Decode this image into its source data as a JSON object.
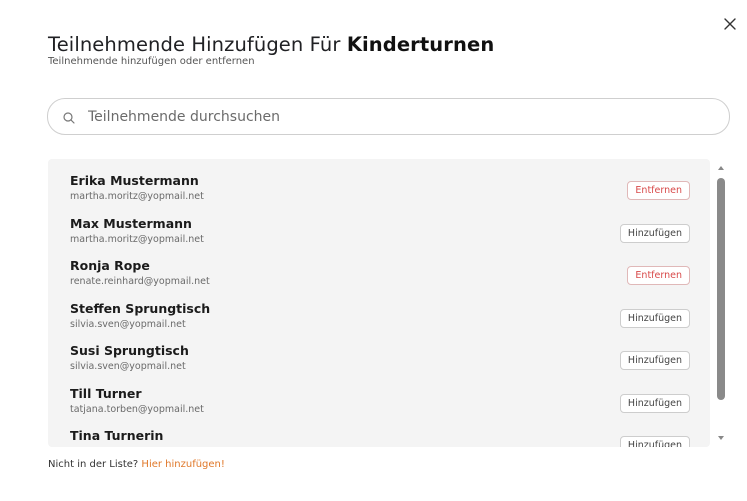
{
  "dialog": {
    "title_prefix": "Teilnehmende Hinzufügen Für",
    "title_course": "Kinderturnen",
    "subtitle": "Teilnehmende hinzufügen oder entfernen"
  },
  "search": {
    "placeholder": "Teilnehmende durchsuchen",
    "value": ""
  },
  "participants": [
    {
      "name": "Erika Mustermann",
      "email": "martha.moritz@yopmail.net",
      "action": "Entfernen",
      "action_type": "remove"
    },
    {
      "name": "Max Mustermann",
      "email": "martha.moritz@yopmail.net",
      "action": "Hinzufügen",
      "action_type": "add"
    },
    {
      "name": "Ronja Rope",
      "email": "renate.reinhard@yopmail.net",
      "action": "Entfernen",
      "action_type": "remove"
    },
    {
      "name": "Steffen Sprungtisch",
      "email": "silvia.sven@yopmail.net",
      "action": "Hinzufügen",
      "action_type": "add"
    },
    {
      "name": "Susi Sprungtisch",
      "email": "silvia.sven@yopmail.net",
      "action": "Hinzufügen",
      "action_type": "add"
    },
    {
      "name": "Till Turner",
      "email": "tatjana.torben@yopmail.net",
      "action": "Hinzufügen",
      "action_type": "add"
    },
    {
      "name": "Tina Turnerin",
      "email": "",
      "action": "Hinzufügen",
      "action_type": "add"
    }
  ],
  "footer": {
    "question": "Nicht in der Liste?",
    "link": "Hier hinzufügen!"
  },
  "colors": {
    "remove_text": "#d84a4a",
    "link": "#e0782a",
    "list_background": "#f4f4f4"
  },
  "icons": {
    "close": "close-icon",
    "search": "search-icon"
  }
}
